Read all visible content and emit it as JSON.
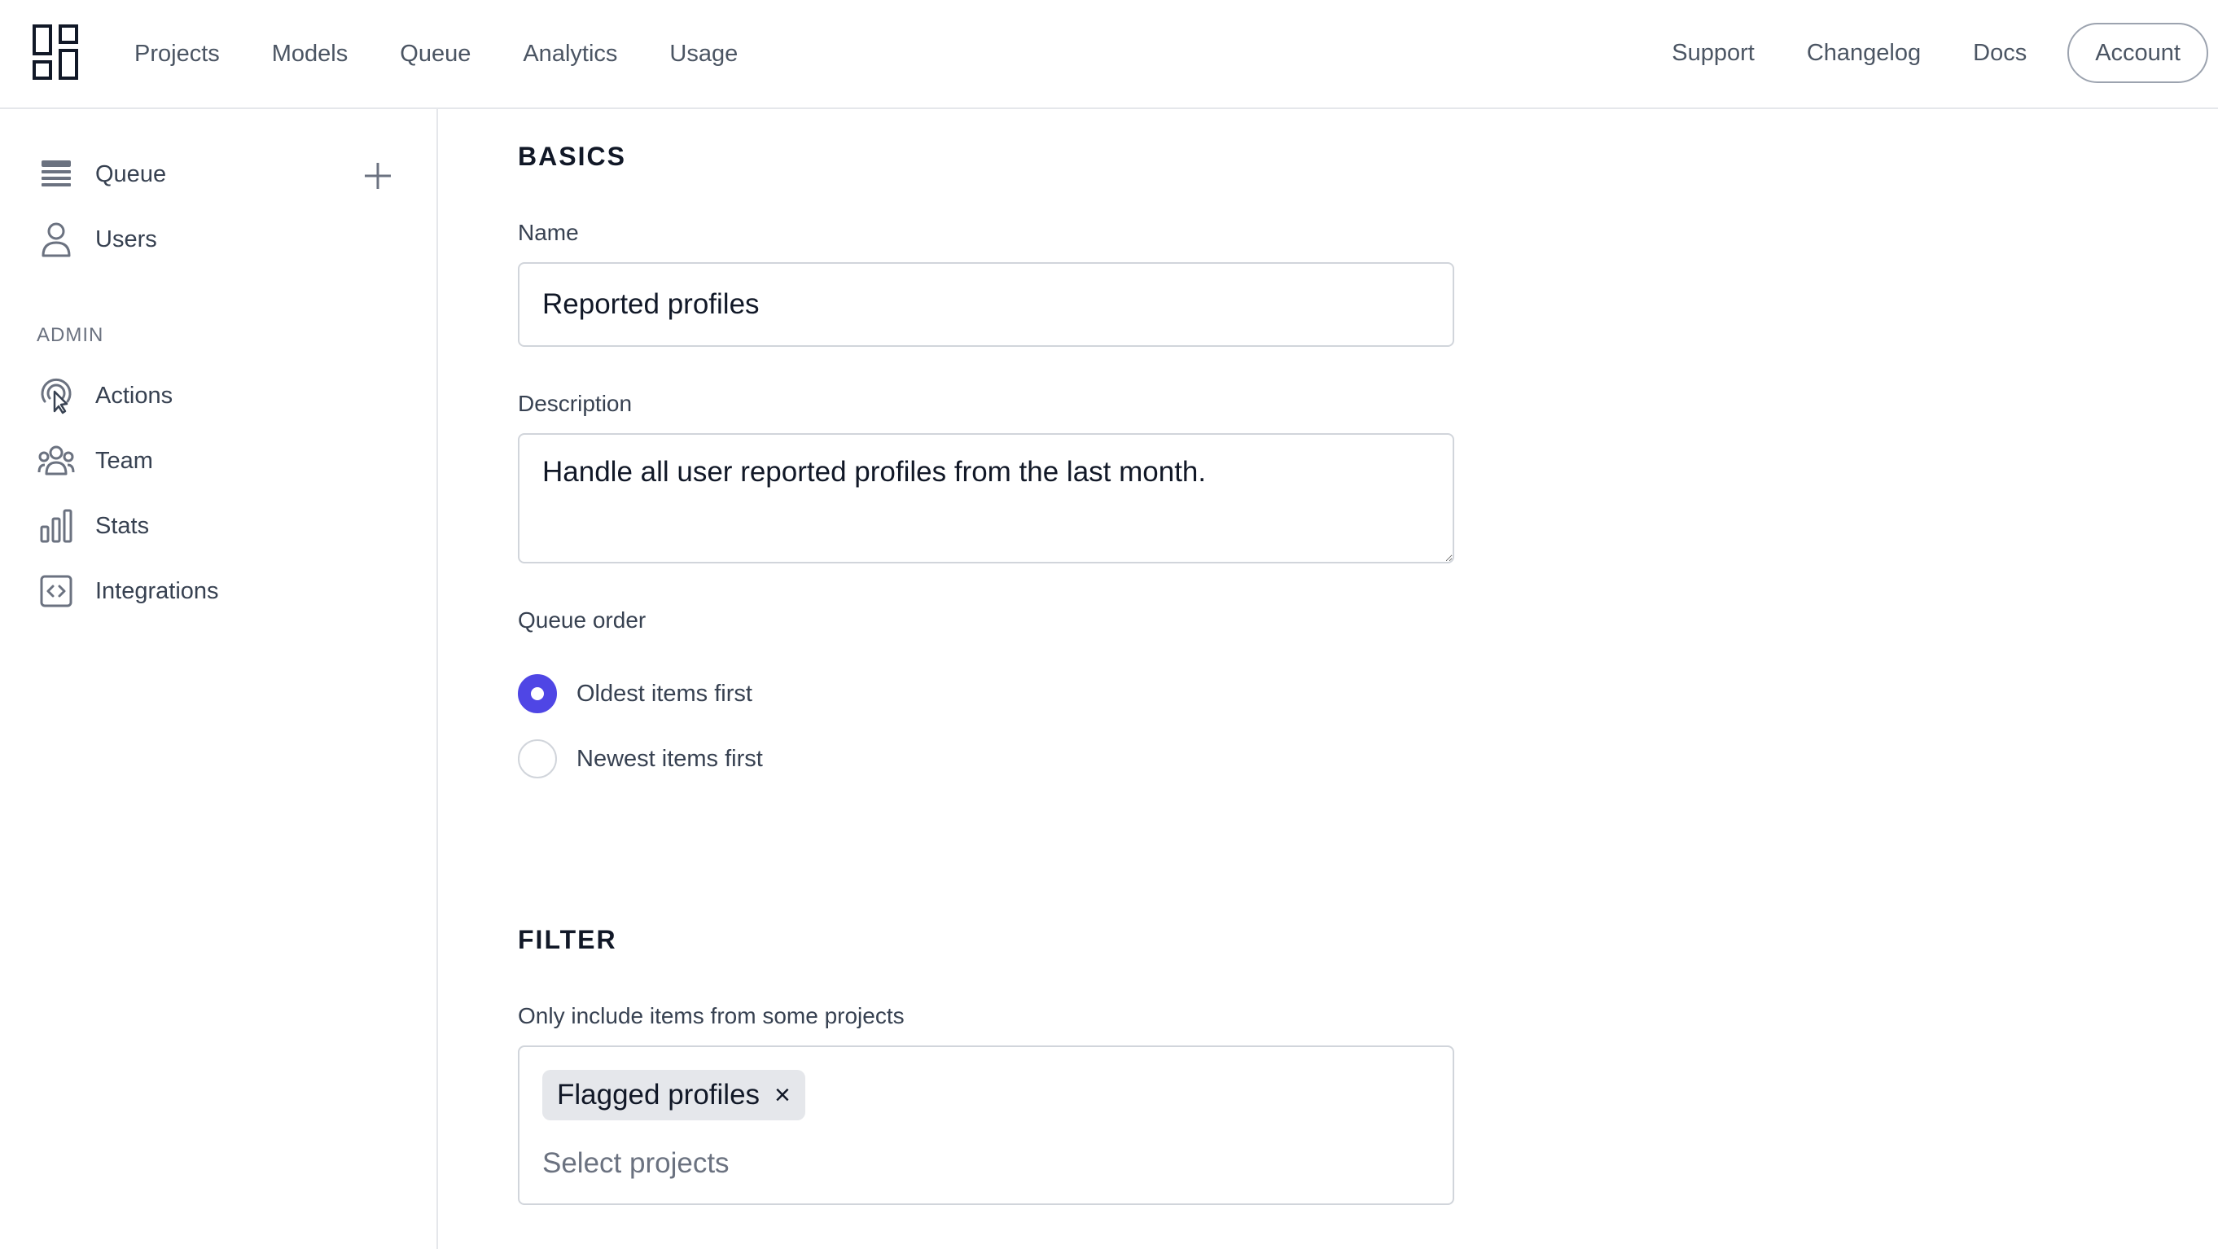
{
  "header": {
    "nav": [
      "Projects",
      "Models",
      "Queue",
      "Analytics",
      "Usage"
    ],
    "links": [
      "Support",
      "Changelog",
      "Docs"
    ],
    "account_label": "Account"
  },
  "sidebar": {
    "items": [
      {
        "label": "Queue",
        "icon": "queue-icon"
      },
      {
        "label": "Users",
        "icon": "user-icon"
      }
    ],
    "admin_heading": "ADMIN",
    "admin_items": [
      {
        "label": "Actions",
        "icon": "cursor-click-icon"
      },
      {
        "label": "Team",
        "icon": "team-icon"
      },
      {
        "label": "Stats",
        "icon": "bar-chart-icon"
      },
      {
        "label": "Integrations",
        "icon": "code-icon"
      }
    ]
  },
  "form": {
    "basics_title": "BASICS",
    "name_label": "Name",
    "name_value": "Reported profiles",
    "description_label": "Description",
    "description_value": "Handle all user reported profiles from the last month.",
    "queue_order_label": "Queue order",
    "queue_order_options": [
      {
        "label": "Oldest items first",
        "checked": true
      },
      {
        "label": "Newest items first",
        "checked": false
      }
    ],
    "filter_title": "FILTER",
    "projects_label": "Only include items from some projects",
    "selected_projects": [
      "Flagged profiles"
    ],
    "remove_glyph": "×",
    "projects_placeholder": "Select projects"
  },
  "colors": {
    "accent": "#4f46e5",
    "border": "#d1d5db",
    "chip_bg": "#e5e7eb"
  }
}
